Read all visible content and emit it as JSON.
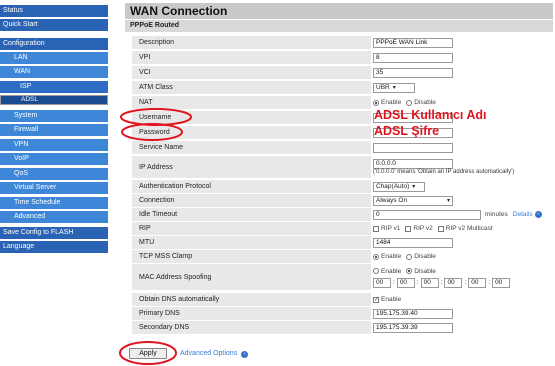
{
  "sidebar": {
    "items": [
      {
        "label": "Status",
        "level": 0
      },
      {
        "label": "Quick Start",
        "level": 0
      },
      {
        "label": "Configuration",
        "level": 0
      },
      {
        "label": "LAN",
        "level": 1
      },
      {
        "label": "WAN",
        "level": 1
      },
      {
        "label": "ISP",
        "level": 2
      },
      {
        "label": "ADSL",
        "level": 2
      },
      {
        "label": "System",
        "level": 1
      },
      {
        "label": "Firewall",
        "level": 1
      },
      {
        "label": "VPN",
        "level": 1
      },
      {
        "label": "VoIP",
        "level": 1
      },
      {
        "label": "QoS",
        "level": 1
      },
      {
        "label": "Virtual Server",
        "level": 1
      },
      {
        "label": "Time Schedule",
        "level": 1
      },
      {
        "label": "Advanced",
        "level": 1
      },
      {
        "label": "Save Config to FLASH",
        "level": 0
      },
      {
        "label": "Language",
        "level": 0
      }
    ]
  },
  "page": {
    "title": "WAN Connection",
    "section": "PPPoE Routed"
  },
  "form": {
    "description": {
      "label": "Description",
      "value": "PPPoE WAN Link"
    },
    "vpi": {
      "label": "VPI",
      "value": "8"
    },
    "vci": {
      "label": "VCI",
      "value": "35"
    },
    "atm_class": {
      "label": "ATM Class",
      "value": "UBR"
    },
    "nat": {
      "label": "NAT",
      "enable": "Enable",
      "disable": "Disable"
    },
    "username": {
      "label": "Username",
      "value": ""
    },
    "password": {
      "label": "Password",
      "value": ""
    },
    "service_name": {
      "label": "Service Name",
      "value": ""
    },
    "ip_address": {
      "label": "IP Address",
      "value": "0.0.0.0",
      "note": "('0.0.0.0' means 'Obtain an IP address automatically')"
    },
    "auth_protocol": {
      "label": "Authentication Protocol",
      "value": "Chap(Auto)"
    },
    "connection": {
      "label": "Connection",
      "value": "Always On"
    },
    "idle_timeout": {
      "label": "Idle Timeout",
      "value": "0",
      "unit": "minutes",
      "details": "Details"
    },
    "rip": {
      "label": "RIP",
      "v1": "RIP v1",
      "v2": "RIP v2",
      "v2m": "RIP v2 Multicast"
    },
    "mtu": {
      "label": "MTU",
      "value": "1484"
    },
    "tcp_mss": {
      "label": "TCP MSS Clamp",
      "enable": "Enable",
      "disable": "Disable"
    },
    "mac_spoof": {
      "label": "MAC Address Spoofing",
      "enable": "Enable",
      "disable": "Disable",
      "fields": [
        "00",
        "00",
        "00",
        "00",
        "00",
        "00"
      ]
    },
    "obtain_dns": {
      "label": "Obtain DNS automatically",
      "enable": "Enable",
      "check": "✓"
    },
    "primary_dns": {
      "label": "Primary DNS",
      "value": "195.175.39.40"
    },
    "secondary_dns": {
      "label": "Secondary DNS",
      "value": "195.175.39.39"
    }
  },
  "annotations": {
    "username_note": "ADSL Kullanıcı Adı",
    "password_note": "ADSL Şifre",
    "color": "#e0141e"
  },
  "actions": {
    "apply": "Apply",
    "advanced_options": "Advanced Options"
  },
  "colors": {
    "sidebar_top": "#2a62b4",
    "sidebar_sub": "#3d86d8",
    "label_bg": "#e8e8e8",
    "title_bg": "#c9c9c9"
  }
}
